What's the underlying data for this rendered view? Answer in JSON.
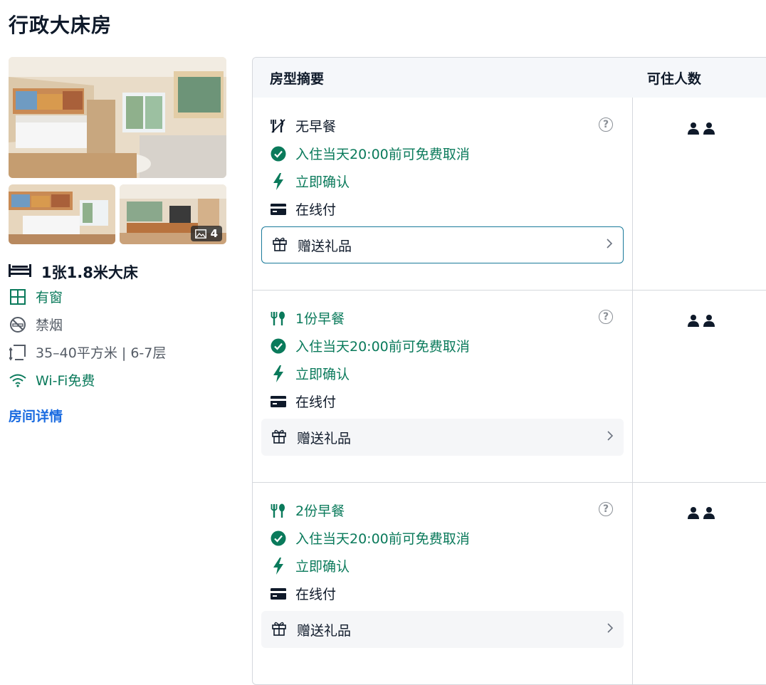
{
  "room": {
    "title": "行政大床房",
    "photo_count": "4",
    "bed": "1张1.8米大床",
    "facilities": [
      {
        "icon": "window-icon",
        "text": "有窗",
        "color": "#0a7a5b"
      },
      {
        "icon": "no-smoking-icon",
        "text": "禁烟",
        "color": "#555c66"
      },
      {
        "icon": "area-icon",
        "text": "35–40平方米 | 6-7层",
        "color": "#555c66"
      },
      {
        "icon": "wifi-icon",
        "text": "Wi-Fi免费",
        "color": "#0a7a5b"
      }
    ],
    "detail_link": "房间详情"
  },
  "table": {
    "col_summary": "房型摘要",
    "col_guests": "可住人数"
  },
  "plans": [
    {
      "meal": "无早餐",
      "meal_icon": "no-meal-icon",
      "meal_color": "#0f1a2a",
      "cancel": "入住当天20:00前可免费取消",
      "confirm": "立即确认",
      "payment": "在线付",
      "gift": "赠送礼品",
      "guests": 2,
      "gift_active": true
    },
    {
      "meal": "1份早餐",
      "meal_icon": "meal-icon",
      "meal_color": "#0a7a5b",
      "cancel": "入住当天20:00前可免费取消",
      "confirm": "立即确认",
      "payment": "在线付",
      "gift": "赠送礼品",
      "guests": 2,
      "gift_active": false
    },
    {
      "meal": "2份早餐",
      "meal_icon": "meal-icon",
      "meal_color": "#0a7a5b",
      "cancel": "入住当天20:00前可免费取消",
      "confirm": "立即确认",
      "payment": "在线付",
      "gift": "赠送礼品",
      "guests": 2,
      "gift_active": false
    }
  ],
  "colors": {
    "green": "#0a7a5b",
    "link": "#1a6be0",
    "text": "#0f1a2a"
  }
}
